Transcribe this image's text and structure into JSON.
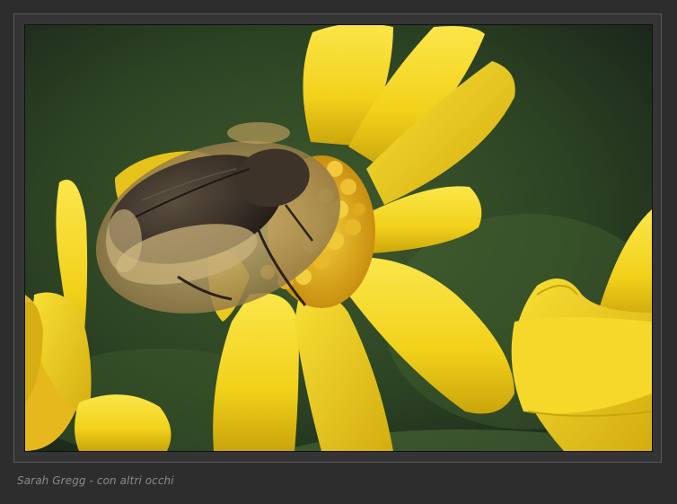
{
  "caption": {
    "text": "Sarah Gregg - con altri occhi"
  },
  "photo": {
    "subject": "beetle-on-yellow-flower",
    "colors": {
      "background_dark": "#1f2d1c",
      "background_mid": "#3e5a2c",
      "petal": "#f2d11a",
      "petal_highlight": "#fbe64a",
      "petal_shadow": "#c9a50c",
      "disc": "#e8b81c",
      "beetle_body": "#3a3128",
      "beetle_fur": "#b49a62",
      "frame": "#343434",
      "page": "#2d2d2d"
    }
  }
}
